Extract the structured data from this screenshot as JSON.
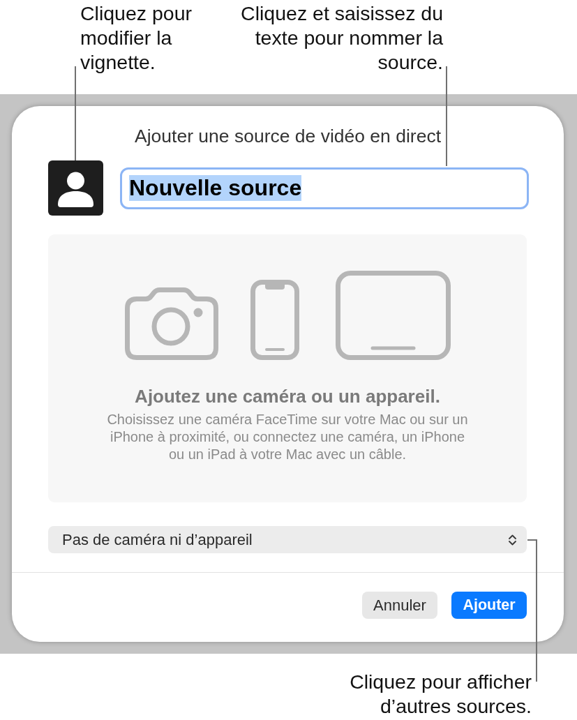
{
  "thumbnail_callout": {
    "text": "Cliquez pour\nmodifier la\nvignette."
  },
  "name_callout": {
    "text": "Cliquez et saisissez du\ntexte pour nommer la\nsource."
  },
  "dialog": {
    "title": "Ajouter une source de vidéo en direct",
    "name_field": {
      "value": "Nouvelle source",
      "focused": true,
      "text_selected": true
    },
    "empty_state": {
      "heading": "Ajoutez une caméra ou un appareil.",
      "body": "Choisissez une caméra FaceTime sur votre Mac ou sur un\niPhone à proximité, ou connectez une caméra, un iPhone\nou un iPad à votre Mac avec un câble."
    },
    "source_popup": {
      "value": "Pas de caméra ni d’appareil"
    },
    "buttons": [
      {
        "label": "Annuler",
        "kind": "secondary"
      },
      {
        "label": "Ajouter",
        "kind": "primary"
      }
    ]
  },
  "sources_callout": {
    "text": "Cliquez pour afficher\nd’autres sources."
  }
}
